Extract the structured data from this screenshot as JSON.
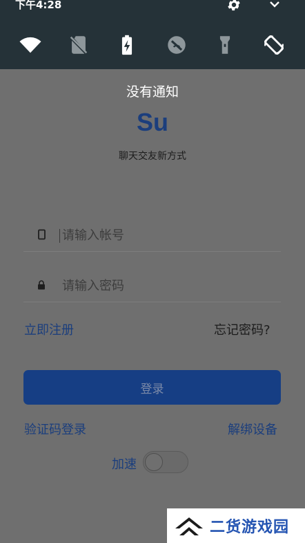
{
  "status_bar": {
    "time": "下午4:28",
    "settings_icon": "gear-icon",
    "expand_icon": "chevron-down-icon"
  },
  "quick_settings": {
    "tiles": [
      {
        "icon": "wifi-icon"
      },
      {
        "icon": "no-sim-icon"
      },
      {
        "icon": "battery-saver-icon"
      },
      {
        "icon": "data-saver-icon"
      },
      {
        "icon": "flashlight-icon"
      },
      {
        "icon": "auto-rotate-icon"
      }
    ],
    "no_notifications": "没有通知"
  },
  "login": {
    "logo": "Su",
    "tagline": "聊天交友新方式",
    "account_placeholder": "请输入帐号",
    "account_value": "",
    "password_placeholder": "请输入密码",
    "password_value": "",
    "register_link": "立即注册",
    "forgot_password": "忘记密码?",
    "login_button": "登录",
    "sms_login_link": "验证码登录",
    "unbind_device_link": "解绑设备",
    "accelerate_label": "加速",
    "accelerate_on": false
  },
  "watermark": {
    "text": "二货游戏园"
  },
  "colors": {
    "shade": "#253238",
    "accent": "#1b3e7d",
    "button": "#163e84",
    "overlay": "#6f6f6f"
  }
}
